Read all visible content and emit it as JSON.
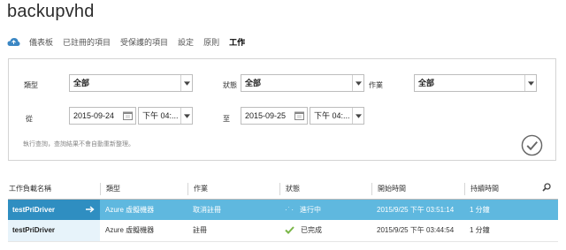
{
  "page": {
    "title": "backupvhd"
  },
  "nav": {
    "icon": "cloud-icon",
    "items": [
      {
        "label": "儀表板",
        "active": false
      },
      {
        "label": "已註冊的項目",
        "active": false
      },
      {
        "label": "受保護的項目",
        "active": false
      },
      {
        "label": "設定",
        "active": false
      },
      {
        "label": "原則",
        "active": false
      },
      {
        "label": "工作",
        "active": true
      }
    ]
  },
  "filters": {
    "type_label": "類型",
    "type_value": "全部",
    "status_label": "狀態",
    "status_value": "全部",
    "operation_label": "作業",
    "operation_value": "全部",
    "from_label": "從",
    "from_date": "2015-09-24",
    "from_time": "下午 04:...",
    "to_label": "至",
    "to_date": "2015-09-25",
    "to_time": "下午 04:...",
    "hint": "執行查詢，查詢結果不會自動重新整理。"
  },
  "table": {
    "headers": [
      "工作負載名稱",
      "類型",
      "作業",
      "狀態",
      "開始時間",
      "持續時間"
    ],
    "rows": [
      {
        "name": "testPriDriver",
        "type": "Azure 虛擬機器",
        "operation": "取消註冊",
        "status_icon": "progress-dots",
        "status": "進行中",
        "start": "2015/9/25 下午 03:51:14",
        "duration": "1 分鐘"
      },
      {
        "name": "testPriDriver",
        "type": "Azure 虛擬機器",
        "operation": "註冊",
        "status_icon": "check-icon",
        "status": "已完成",
        "start": "2015/9/25 下午 03:44:54",
        "duration": "1 分鐘"
      }
    ]
  },
  "colors": {
    "selected_row": "#5fb8df",
    "selected_name": "#2f8ec1",
    "check": "#7ab648"
  }
}
